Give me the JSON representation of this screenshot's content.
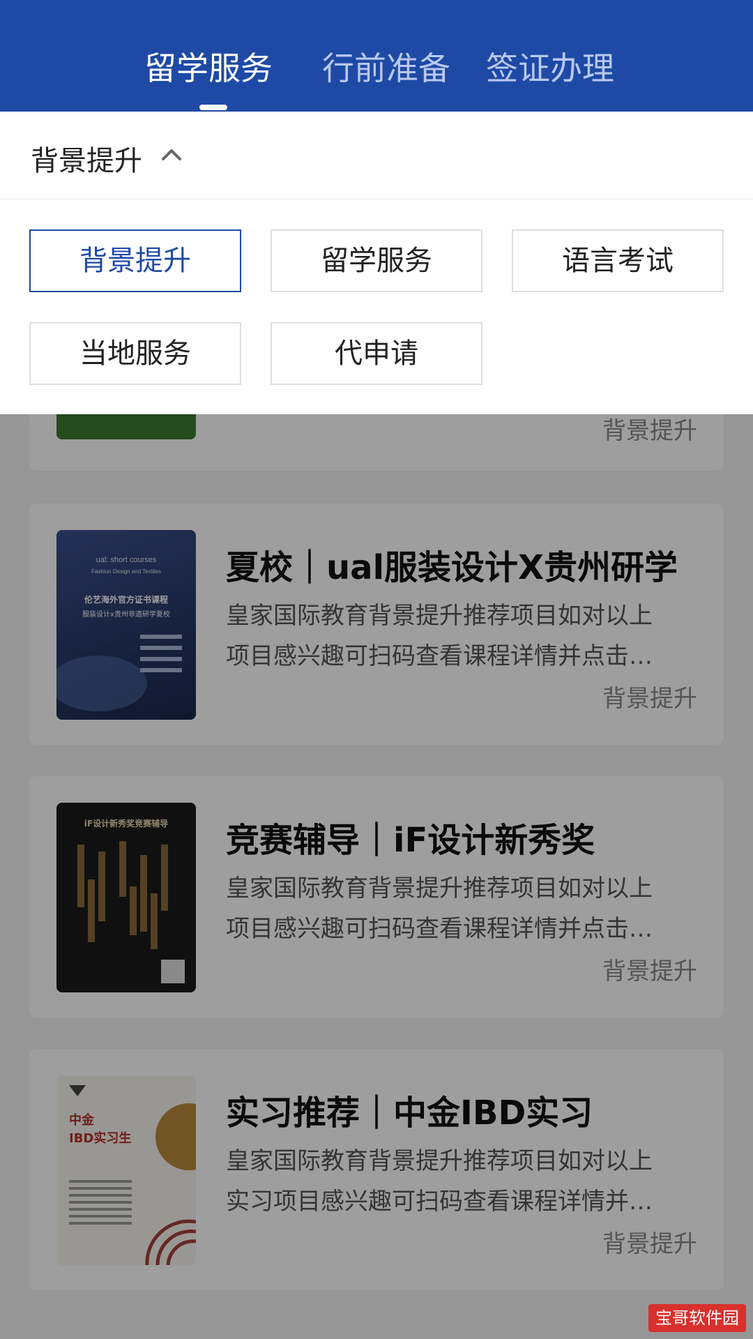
{
  "tabs": [
    "留学服务",
    "行前准备",
    "签证办理"
  ],
  "dropdown": {
    "title": "背景提升",
    "options": [
      "背景提升",
      "留学服务",
      "语言考试",
      "当地服务",
      "代申请"
    ]
  },
  "cards": [
    {
      "tag": "背景提升"
    },
    {
      "title": "夏校｜ual服装设计X贵州研学",
      "desc": [
        "皇家国际教育背景提升推荐项目如对以上",
        "项目感兴趣可扫码查看课程详情并点击…"
      ],
      "tag": "背景提升",
      "thumb_text": [
        "ual: short courses",
        "Fashion Design and Textiles",
        "伦艺海外官方证书课程",
        "服装设计x贵州非遗研学夏校"
      ]
    },
    {
      "title": "竞赛辅导｜iF设计新秀奖",
      "desc": [
        "皇家国际教育背景提升推荐项目如对以上",
        "项目感兴趣可扫码查看课程详情并点击…"
      ],
      "tag": "背景提升",
      "thumb_text": [
        "iF设计新秀奖竞赛辅导"
      ]
    },
    {
      "title": "实习推荐｜中金IBD实习",
      "desc": [
        "皇家国际教育背景提升推荐项目如对以上",
        "实习项目感兴趣可扫码查看课程详情并…"
      ],
      "tag": "背景提升",
      "thumb_text": [
        "中金",
        "IBD实习生"
      ]
    }
  ],
  "watermark": "宝哥软件园",
  "colors": {
    "header_bg": "#1e4aa6",
    "selected": "#1e4aa6"
  }
}
